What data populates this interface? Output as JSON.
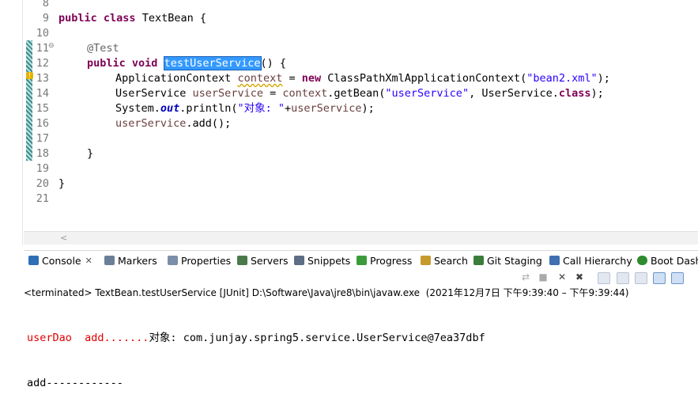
{
  "editor": {
    "line_numbers": [
      "8",
      "9",
      "10",
      "11",
      "12",
      "13",
      "14",
      "15",
      "16",
      "17",
      "18",
      "19",
      "20",
      "21"
    ],
    "fold_marker": "⊖",
    "lines": {
      "l9": {
        "kw1": "public",
        "kw2": "class",
        "rest": " TextBean {"
      },
      "l11": {
        "annotation": "@Test"
      },
      "l12": {
        "kw1": "public",
        "kw2": "void",
        "selected": "testUserService",
        "rest": "() {"
      },
      "l13": {
        "type": "ApplicationContext ",
        "var": "context",
        "eq": " = ",
        "kw": "new",
        "call": " ClassPathXmlApplicationContext(",
        "str": "\"bean2.xml\"",
        "end": ");"
      },
      "l14": {
        "type": "UserService ",
        "var": "userService",
        "mid": " = ",
        "var2": "context",
        "call": ".getBean(",
        "str": "\"userService\"",
        "mid2": ", UserService.",
        "kw": "class",
        "end": ");"
      },
      "l15": {
        "pre": "System.",
        "fld": "out",
        "call": ".println(",
        "str": "\"对象: \"",
        "plus": "+",
        "var": "userService",
        "end": ");"
      },
      "l16": {
        "var": "userService",
        "rest": ".add();"
      },
      "l18": {
        "brace": "}"
      },
      "l20": {
        "brace": "}"
      }
    }
  },
  "views": {
    "tabs": [
      {
        "label": "Console",
        "icon": "console-icon",
        "color": "#2f6fb5",
        "closable": true
      },
      {
        "label": "Markers",
        "icon": "markers-icon",
        "color": "#6b7f99"
      },
      {
        "label": "Properties",
        "icon": "properties-icon",
        "color": "#7c8ea8"
      },
      {
        "label": "Servers",
        "icon": "servers-icon",
        "color": "#4a7a4a"
      },
      {
        "label": "Snippets",
        "icon": "snippets-icon",
        "color": "#5c6d85"
      },
      {
        "label": "Progress",
        "icon": "progress-icon",
        "color": "#3a9b3a"
      },
      {
        "label": "Search",
        "icon": "search-icon",
        "color": "#c79a2e"
      },
      {
        "label": "Git Staging",
        "icon": "git-staging-icon",
        "color": "#3a7d3a"
      },
      {
        "label": "Call Hierarchy",
        "icon": "call-hierarchy-icon",
        "color": "#3f6fb0"
      },
      {
        "label": "Boot Dash",
        "icon": "boot-dashboard-icon",
        "color": "#2e8b2e"
      }
    ],
    "close_glyph": "✕"
  },
  "console": {
    "status": "<terminated> TextBean.testUserService [JUnit] D:\\Software\\Java\\jre8\\bin\\javaw.exe  (2021年12月7日 下午9:39:40 – 下午9:39:44)",
    "out_line1_red": "userDao  add.......",
    "out_line1_black": "对象: com.junjay.spring5.service.UserService@7ea37dbf",
    "out_line2": "add------------"
  },
  "colors": {
    "keyword": "#7f0055",
    "string": "#2a00ff",
    "annotation": "#646464",
    "variable": "#6a3e3e",
    "selection": "#3399ff",
    "stderr": "#e00000"
  }
}
